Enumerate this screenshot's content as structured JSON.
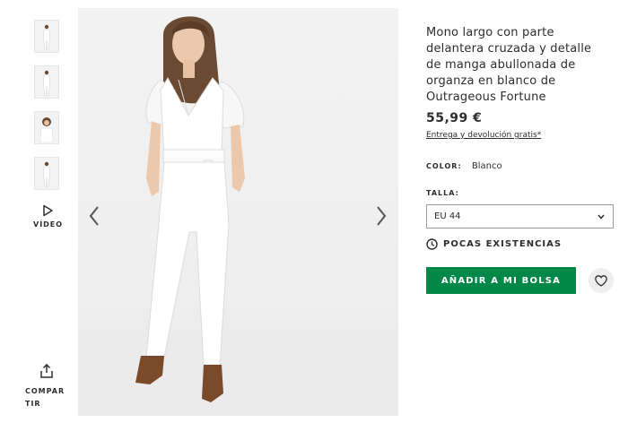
{
  "gallery": {
    "thumbnails": [
      "thumbnail-1",
      "thumbnail-2",
      "thumbnail-3",
      "thumbnail-4"
    ],
    "video_label": "VÍDEO",
    "share_label": "COMPARTIR"
  },
  "product": {
    "title": "Mono largo con parte delantera cruzada y detalle de manga abullonada de organza en blanco de Outrageous Fortune",
    "price": "55,99 €",
    "shipping_link": "Entrega y devolución gratis*",
    "color_label": "COLOR:",
    "color_value": "Blanco",
    "size_label": "TALLA:",
    "size_selected": "EU 44",
    "stock_text": "POCAS EXISTENCIAS",
    "add_to_bag": "AÑADIR A MI BOLSA"
  },
  "colors": {
    "accent_green": "#018849",
    "text": "#2d2d2d",
    "photo_bg": "#f0f0f0"
  },
  "icons": [
    "play-icon",
    "share-icon",
    "chevron-left-icon",
    "chevron-right-icon",
    "chevron-down-icon",
    "clock-icon",
    "heart-icon"
  ]
}
